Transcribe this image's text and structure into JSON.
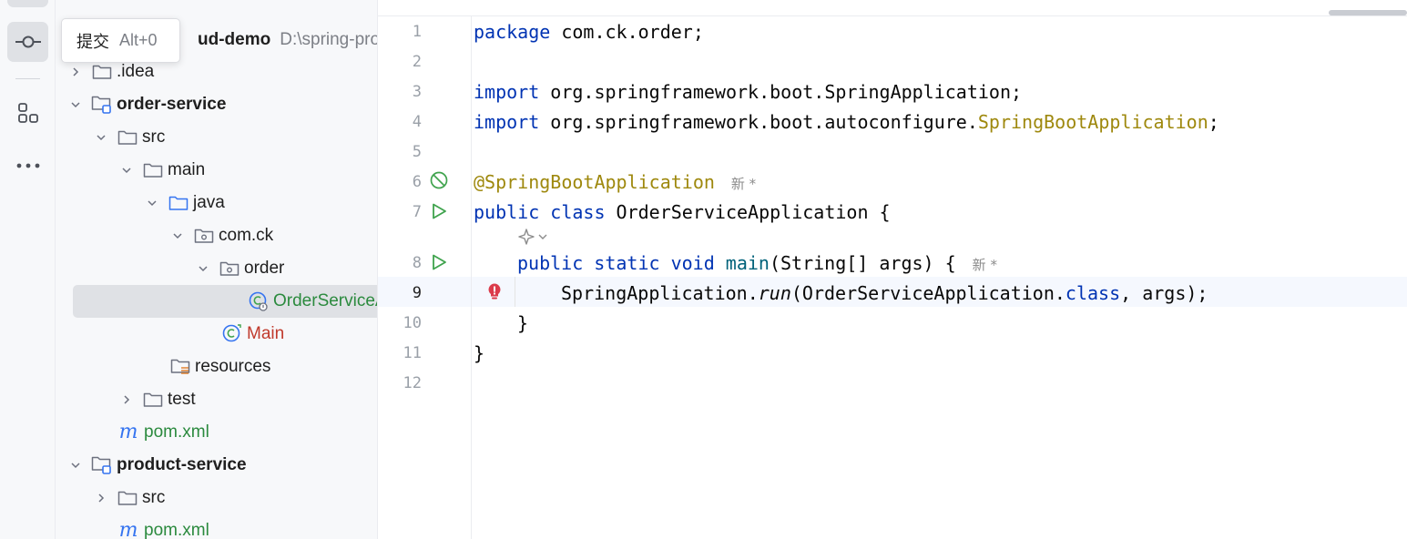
{
  "tooltip": {
    "label": "提交",
    "shortcut": "Alt+0"
  },
  "activity_bar": {
    "items": [
      {
        "name": "commit",
        "icon": "commit-icon"
      },
      {
        "name": "structure",
        "icon": "structure-icon"
      },
      {
        "name": "more",
        "icon": "more-icon"
      }
    ]
  },
  "project_tree": {
    "root": {
      "name": "ud-demo",
      "path": "D:\\spring-proje"
    },
    "items": [
      {
        "label": ".idea"
      },
      {
        "label": "order-service"
      },
      {
        "label": "src"
      },
      {
        "label": "main"
      },
      {
        "label": "java"
      },
      {
        "label": "com.ck"
      },
      {
        "label": "order"
      },
      {
        "label": "OrderServiceA"
      },
      {
        "label": "Main"
      },
      {
        "label": "resources"
      },
      {
        "label": "test"
      },
      {
        "label": "pom.xml"
      },
      {
        "label": "product-service"
      },
      {
        "label": "src"
      },
      {
        "label": "pom.xml"
      }
    ]
  },
  "editor": {
    "line_numbers": [
      "1",
      "2",
      "3",
      "4",
      "5",
      "6",
      "7",
      "8",
      "9",
      "10",
      "11",
      "12"
    ],
    "code": {
      "l1_kw": "package",
      "l1_rest": " com.ck.order;",
      "l3_kw": "import",
      "l3_rest": " org.springframework.boot.SpringApplication;",
      "l4_kw": "import",
      "l4_rest": " org.springframework.boot.autoconfigure.",
      "l4_ann": "SpringBootApplication",
      "l4_end": ";",
      "l6_ann": "@SpringBootApplication",
      "l6_hint": "新 *",
      "l7_kw": "public class",
      "l7_rest": " OrderServiceApplication {",
      "l8_kw": "public static void",
      "l8_fn": "main",
      "l8_rest": "(String[] args) {",
      "l8_hint": "新 *",
      "l9_a": "SpringApplication.",
      "l9_run": "run",
      "l9_b": "(OrderServiceApplication.",
      "l9_kw": "class",
      "l9_c": ", args);",
      "l10": "}",
      "l11": "}"
    }
  },
  "colors": {
    "keyword": "#0033b3",
    "annotation": "#9e880d",
    "function": "#00627a",
    "green_file": "#2b8a3e",
    "red_file": "#c0392b",
    "run_icon": "#3fa34d",
    "error_icon": "#db3b4b"
  }
}
